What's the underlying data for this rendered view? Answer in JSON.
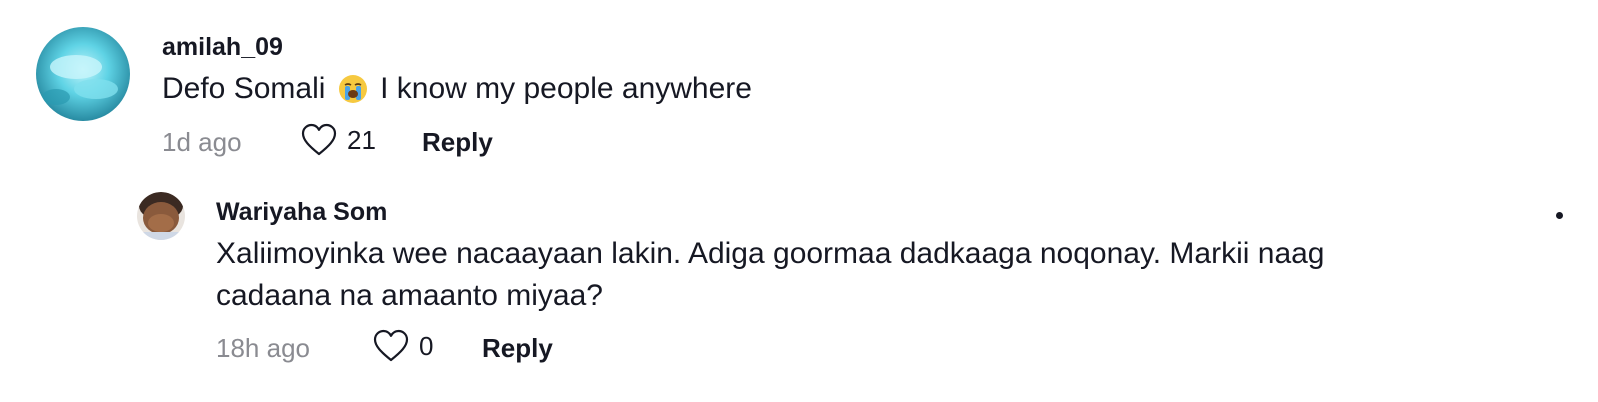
{
  "comments": [
    {
      "username": "amilah_09",
      "text_before_emoji": "Defo Somali",
      "emoji": "loudly-crying-face",
      "text_after_emoji": "I know my people anywhere",
      "time": "1d ago",
      "likes": "21",
      "reply_label": "Reply"
    },
    {
      "username": "Wariyaha Som",
      "text": "Xaliimoyinka wee nacaayaan lakin. Adiga goormaa dadkaaga noqonay. Markii naag cadaana na amaanto miyaa?",
      "time": "18h ago",
      "likes": "0",
      "reply_label": "Reply"
    }
  ],
  "colors": {
    "text": "#161823",
    "muted": "#8a8b91",
    "avatar1": "#4fc8dc"
  }
}
